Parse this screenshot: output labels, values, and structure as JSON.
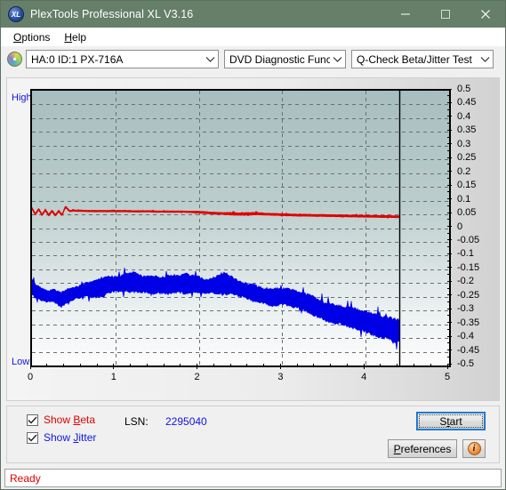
{
  "window": {
    "title": "PlexTools Professional XL V3.16",
    "app_icon": "xl-logo-icon",
    "minimize_label": "minimize-icon",
    "maximize_label": "maximize-icon",
    "close_label": "close-icon",
    "titlebar_color": "#657f69"
  },
  "menu": {
    "items": [
      {
        "label": "Options",
        "mnemonic": "O",
        "rest": "ptions"
      },
      {
        "label": "Help",
        "mnemonic": "H",
        "rest": "elp"
      }
    ]
  },
  "toolbar": {
    "drive_icon": "disc-icon",
    "drive": "HA:0 ID:1  PX-716A",
    "function": "DVD Diagnostic Functions",
    "test": "Q-Check Beta/Jitter Test"
  },
  "chart_labels": {
    "high": "High",
    "low": "Low"
  },
  "controls": {
    "show_beta": {
      "label": "Show Beta",
      "pre": "Show ",
      "mnemonic": "B",
      "post": "eta",
      "checked": true,
      "color": "#e00000"
    },
    "show_jitter": {
      "label": "Show Jitter",
      "pre": "Show ",
      "mnemonic": "J",
      "post": "itter",
      "checked": true,
      "color": "#1414e0"
    },
    "lsn_label": "LSN:",
    "lsn_value": "2295040",
    "start_label": "Start",
    "start_pre": "S",
    "start_mnemonic": "t",
    "start_post": "art",
    "preferences_label": "Preferences",
    "prefs_mnemonic": "P",
    "prefs_rest": "references",
    "info_label": "i",
    "info_icon": "info-icon"
  },
  "status": {
    "text": "Ready",
    "color": "#e00000"
  },
  "chart_data": {
    "type": "line",
    "title": "Q-Check Beta/Jitter Test",
    "xlabel": "",
    "ylabel": "",
    "xlim": [
      0,
      5
    ],
    "ylim": [
      -0.5,
      0.5
    ],
    "xticks": [
      0,
      1,
      2,
      3,
      4,
      5
    ],
    "yticks": [
      0.5,
      0.45,
      0.4,
      0.35,
      0.3,
      0.25,
      0.2,
      0.15,
      0.1,
      0.05,
      0,
      -0.05,
      -0.1,
      -0.15,
      -0.2,
      -0.25,
      -0.3,
      -0.35,
      -0.4,
      -0.45,
      -0.5
    ],
    "ytick_labels": [
      "0.5",
      "0.45",
      "0.4",
      "0.35",
      "0.3",
      "0.25",
      "0.2",
      "0.15",
      "0.1",
      "0.05",
      "0",
      "-0.05",
      "-0.1",
      "-0.15",
      "-0.2",
      "-0.25",
      "-0.3",
      "-0.35",
      "-0.4",
      "-0.45",
      "-0.5"
    ],
    "xtick_labels": [
      "0",
      "1",
      "2",
      "3",
      "4",
      "5"
    ],
    "grid": true,
    "grid_style": "dashed",
    "data_end_x": 4.4,
    "legend_position": "below-plot",
    "series": [
      {
        "name": "Beta",
        "color": "#e00000",
        "band": true,
        "x": [
          0.0,
          0.04,
          0.08,
          0.12,
          0.16,
          0.2,
          0.24,
          0.28,
          0.32,
          0.36,
          0.4,
          0.45,
          0.5,
          0.55,
          0.6,
          0.7,
          0.8,
          0.9,
          1.0,
          1.1,
          1.2,
          1.3,
          1.4,
          1.5,
          1.6,
          1.7,
          1.8,
          1.9,
          2.0,
          2.1,
          2.2,
          2.3,
          2.4,
          2.5,
          2.6,
          2.7,
          2.8,
          2.9,
          3.0,
          3.1,
          3.2,
          3.3,
          3.4,
          3.5,
          3.6,
          3.7,
          3.8,
          3.9,
          4.0,
          4.1,
          4.2,
          4.3,
          4.4
        ],
        "values": [
          0.072,
          0.05,
          0.069,
          0.048,
          0.066,
          0.047,
          0.063,
          0.046,
          0.062,
          0.047,
          0.078,
          0.062,
          0.064,
          0.063,
          0.063,
          0.062,
          0.062,
          0.062,
          0.062,
          0.062,
          0.061,
          0.061,
          0.061,
          0.06,
          0.06,
          0.06,
          0.06,
          0.059,
          0.058,
          0.056,
          0.054,
          0.053,
          0.052,
          0.051,
          0.052,
          0.053,
          0.051,
          0.05,
          0.049,
          0.048,
          0.047,
          0.047,
          0.046,
          0.046,
          0.045,
          0.045,
          0.044,
          0.044,
          0.043,
          0.043,
          0.042,
          0.042,
          0.041
        ],
        "half_width": [
          0.004,
          0.004,
          0.004,
          0.004,
          0.004,
          0.004,
          0.004,
          0.004,
          0.004,
          0.004,
          0.004,
          0.003,
          0.003,
          0.003,
          0.003,
          0.003,
          0.003,
          0.003,
          0.003,
          0.003,
          0.003,
          0.003,
          0.003,
          0.003,
          0.003,
          0.003,
          0.003,
          0.003,
          0.004,
          0.004,
          0.004,
          0.004,
          0.005,
          0.005,
          0.005,
          0.005,
          0.004,
          0.004,
          0.004,
          0.004,
          0.004,
          0.004,
          0.004,
          0.004,
          0.004,
          0.004,
          0.004,
          0.004,
          0.004,
          0.004,
          0.004,
          0.004,
          0.004
        ]
      },
      {
        "name": "Jitter",
        "color": "#0000e6",
        "band": true,
        "x": [
          0.0,
          0.05,
          0.1,
          0.15,
          0.2,
          0.25,
          0.3,
          0.35,
          0.4,
          0.45,
          0.5,
          0.55,
          0.6,
          0.65,
          0.7,
          0.75,
          0.8,
          0.85,
          0.9,
          0.95,
          1.0,
          1.05,
          1.1,
          1.15,
          1.2,
          1.25,
          1.3,
          1.35,
          1.4,
          1.45,
          1.5,
          1.55,
          1.6,
          1.65,
          1.7,
          1.75,
          1.8,
          1.85,
          1.9,
          1.95,
          2.0,
          2.05,
          2.1,
          2.15,
          2.2,
          2.25,
          2.3,
          2.35,
          2.4,
          2.45,
          2.5,
          2.55,
          2.6,
          2.65,
          2.7,
          2.75,
          2.8,
          2.85,
          2.9,
          2.95,
          3.0,
          3.05,
          3.1,
          3.15,
          3.2,
          3.25,
          3.3,
          3.35,
          3.4,
          3.45,
          3.5,
          3.55,
          3.6,
          3.65,
          3.7,
          3.75,
          3.8,
          3.85,
          3.9,
          3.95,
          4.0,
          4.05,
          4.1,
          4.15,
          4.2,
          4.25,
          4.3,
          4.35,
          4.4
        ],
        "values": [
          -0.215,
          -0.232,
          -0.238,
          -0.246,
          -0.248,
          -0.244,
          -0.252,
          -0.262,
          -0.25,
          -0.244,
          -0.238,
          -0.234,
          -0.228,
          -0.224,
          -0.224,
          -0.222,
          -0.22,
          -0.214,
          -0.208,
          -0.205,
          -0.204,
          -0.202,
          -0.2,
          -0.198,
          -0.196,
          -0.198,
          -0.202,
          -0.205,
          -0.206,
          -0.206,
          -0.206,
          -0.208,
          -0.207,
          -0.206,
          -0.204,
          -0.203,
          -0.203,
          -0.205,
          -0.204,
          -0.203,
          -0.206,
          -0.21,
          -0.212,
          -0.21,
          -0.206,
          -0.204,
          -0.202,
          -0.204,
          -0.21,
          -0.216,
          -0.222,
          -0.226,
          -0.23,
          -0.234,
          -0.24,
          -0.244,
          -0.248,
          -0.25,
          -0.252,
          -0.25,
          -0.248,
          -0.25,
          -0.254,
          -0.258,
          -0.262,
          -0.266,
          -0.272,
          -0.28,
          -0.288,
          -0.296,
          -0.302,
          -0.308,
          -0.312,
          -0.314,
          -0.316,
          -0.32,
          -0.324,
          -0.328,
          -0.332,
          -0.336,
          -0.34,
          -0.346,
          -0.352,
          -0.356,
          -0.36,
          -0.362,
          -0.366,
          -0.372,
          -0.374
        ],
        "half_width": [
          0.03,
          0.028,
          0.026,
          0.024,
          0.022,
          0.024,
          0.026,
          0.03,
          0.028,
          0.026,
          0.024,
          0.024,
          0.026,
          0.028,
          0.03,
          0.032,
          0.036,
          0.04,
          0.036,
          0.032,
          0.03,
          0.032,
          0.034,
          0.038,
          0.042,
          0.038,
          0.034,
          0.032,
          0.034,
          0.036,
          0.034,
          0.032,
          0.034,
          0.038,
          0.036,
          0.034,
          0.036,
          0.042,
          0.038,
          0.034,
          0.032,
          0.03,
          0.028,
          0.03,
          0.034,
          0.04,
          0.044,
          0.04,
          0.036,
          0.032,
          0.03,
          0.03,
          0.032,
          0.034,
          0.032,
          0.03,
          0.032,
          0.034,
          0.036,
          0.034,
          0.032,
          0.034,
          0.036,
          0.034,
          0.032,
          0.034,
          0.036,
          0.038,
          0.036,
          0.034,
          0.036,
          0.038,
          0.04,
          0.038,
          0.036,
          0.038,
          0.04,
          0.042,
          0.04,
          0.038,
          0.04,
          0.042,
          0.044,
          0.046,
          0.044,
          0.042,
          0.044,
          0.046,
          0.044
        ]
      }
    ]
  }
}
